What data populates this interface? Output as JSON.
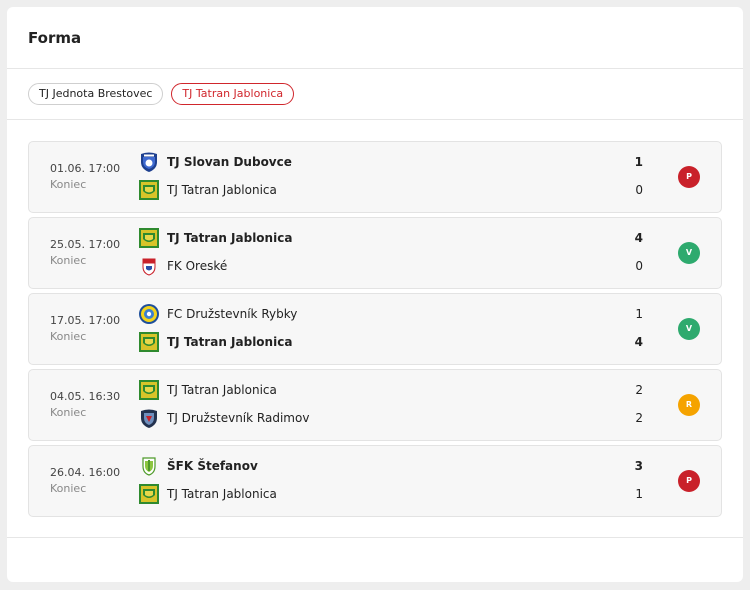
{
  "title": "Forma",
  "tabs": [
    {
      "label": "TJ Jednota Brestovec",
      "active": false
    },
    {
      "label": "TJ Tatran Jablonica",
      "active": true
    }
  ],
  "colors": {
    "accent": "#d0262c",
    "loss": "#c9212a",
    "win": "#2eaa6e",
    "draw": "#f5a300"
  },
  "matches": [
    {
      "date": "01.06. 17:00",
      "status": "Koniec",
      "home": {
        "name": "TJ Slovan Dubovce",
        "score": "1",
        "logo": "shield-logo-blue",
        "winner": true
      },
      "away": {
        "name": "TJ Tatran Jablonica",
        "score": "0",
        "logo": "shield-logo-green",
        "winner": false
      },
      "result": "P"
    },
    {
      "date": "25.05. 17:00",
      "status": "Koniec",
      "home": {
        "name": "TJ Tatran Jablonica",
        "score": "4",
        "logo": "shield-logo-green",
        "winner": true
      },
      "away": {
        "name": "FK Oreské",
        "score": "0",
        "logo": "shield-logo-red-blue",
        "winner": false
      },
      "result": "V"
    },
    {
      "date": "17.05. 17:00",
      "status": "Koniec",
      "home": {
        "name": "FC Družstevník Rybky",
        "score": "1",
        "logo": "round-logo-yellow",
        "winner": false
      },
      "away": {
        "name": "TJ Tatran Jablonica",
        "score": "4",
        "logo": "shield-logo-green",
        "winner": true
      },
      "result": "V"
    },
    {
      "date": "04.05. 16:30",
      "status": "Koniec",
      "home": {
        "name": "TJ Tatran Jablonica",
        "score": "2",
        "logo": "shield-logo-green",
        "winner": false
      },
      "away": {
        "name": "TJ Družstevník Radimov",
        "score": "2",
        "logo": "shield-logo-navy",
        "winner": false
      },
      "result": "R"
    },
    {
      "date": "26.04. 16:00",
      "status": "Koniec",
      "home": {
        "name": "ŠFK Štefanov",
        "score": "3",
        "logo": "shield-logo-light-green",
        "winner": true
      },
      "away": {
        "name": "TJ Tatran Jablonica",
        "score": "1",
        "logo": "shield-logo-green",
        "winner": false
      },
      "result": "P"
    }
  ]
}
